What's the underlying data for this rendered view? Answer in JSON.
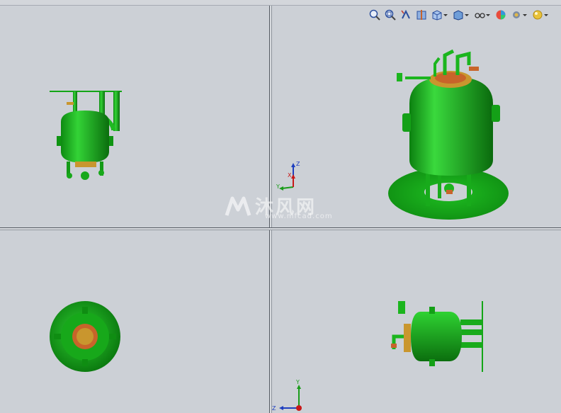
{
  "window": {
    "title": ""
  },
  "toolbar": {
    "buttons": [
      {
        "name": "zoom-to-fit-button",
        "icon": "zoom-fit-icon"
      },
      {
        "name": "zoom-to-area-button",
        "icon": "zoom-area-icon"
      },
      {
        "name": "previous-view-button",
        "icon": "previous-view-icon"
      },
      {
        "name": "section-view-button",
        "icon": "section-view-icon"
      },
      {
        "name": "view-orientation-button",
        "icon": "view-orientation-icon",
        "dropdown": true
      },
      {
        "name": "display-style-button",
        "icon": "display-style-icon",
        "dropdown": true
      },
      {
        "name": "hide-show-items-button",
        "icon": "hide-show-icon",
        "dropdown": true
      },
      {
        "name": "edit-appearance-button",
        "icon": "appearance-icon"
      },
      {
        "name": "apply-scene-button",
        "icon": "scene-icon",
        "dropdown": true
      },
      {
        "name": "view-settings-button",
        "icon": "view-settings-icon",
        "dropdown": true
      }
    ]
  },
  "viewports": {
    "front": {
      "view": "front"
    },
    "isometric": {
      "view": "isometric"
    },
    "top": {
      "view": "top"
    },
    "right": {
      "view": "right"
    }
  },
  "triad": {
    "upper": {
      "z": "Z",
      "x": "X",
      "y": "Y"
    },
    "lower": {
      "y": "Y",
      "z": "Z"
    }
  },
  "watermark": {
    "text": "沐风网",
    "url": "www.mfcad.com"
  },
  "colors": {
    "model_green": "#19b51b",
    "model_dark_green": "#0d7a10",
    "flange_gold": "#c9962e",
    "flange_orange": "#c8642a",
    "viewport_bg": "#ccd0d6",
    "splitter": "#555b63"
  }
}
